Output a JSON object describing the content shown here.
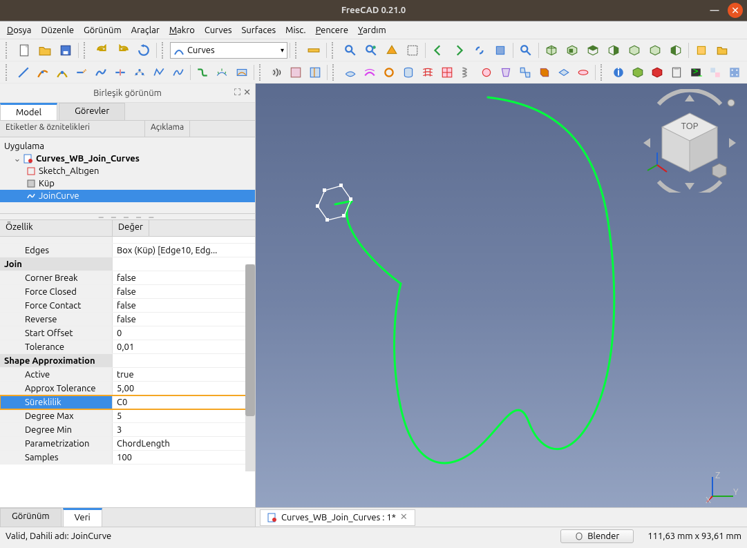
{
  "titlebar": {
    "title": "FreeCAD 0.21.0"
  },
  "menu": {
    "file": "Dosya",
    "edit": "Düzenle",
    "view": "Görünüm",
    "tools": "Araçlar",
    "macro": "Makro",
    "curves": "Curves",
    "surfaces": "Surfaces",
    "misc": "Misc.",
    "windows": "Pencere",
    "help": "Yardım"
  },
  "workbench": {
    "name": "Curves"
  },
  "panel": {
    "title": "Birleşik görünüm",
    "tabs": {
      "model": "Model",
      "tasks": "Görevler"
    },
    "tree_head": {
      "labels": "Etiketler & öznitelikleri",
      "desc": "Açıklama"
    },
    "app": "Uygulama",
    "doc": "Curves_WB_Join_Curves",
    "items": {
      "sketch": "Sketch_Altıgen",
      "cube": "Küp",
      "join": "JoinCurve"
    }
  },
  "props": {
    "head": {
      "property": "Özellik",
      "value": "Değer"
    },
    "rows": [
      {
        "name": "Edges",
        "value": "Box (Küp) [Edge10, Edg...",
        "ind": true
      },
      {
        "grp": true,
        "name": "Join",
        "value": ""
      },
      {
        "name": "Corner Break",
        "value": "false",
        "ind": true
      },
      {
        "name": "Force Closed",
        "value": "false",
        "ind": true
      },
      {
        "name": "Force Contact",
        "value": "false",
        "ind": true
      },
      {
        "name": "Reverse",
        "value": "false",
        "ind": true
      },
      {
        "name": "Start Offset",
        "value": "0",
        "ind": true
      },
      {
        "name": "Tolerance",
        "value": "0,01",
        "ind": true
      },
      {
        "grp": true,
        "name": "Shape Approximation",
        "value": ""
      },
      {
        "name": "Active",
        "value": "true",
        "ind": true
      },
      {
        "name": "Approx Tolerance",
        "value": "5,00",
        "ind": true
      },
      {
        "name": "Süreklilik",
        "value": "C0",
        "ind": true,
        "hl": true
      },
      {
        "name": "Degree Max",
        "value": "5",
        "ind": true
      },
      {
        "name": "Degree Min",
        "value": "3",
        "ind": true
      },
      {
        "name": "Parametrization",
        "value": "ChordLength",
        "ind": true
      },
      {
        "name": "Samples",
        "value": "100",
        "ind": true
      }
    ],
    "tabs": {
      "view": "Görünüm",
      "data": "Veri"
    }
  },
  "doc_tab": {
    "label": "Curves_WB_Join_Curves : 1*"
  },
  "status": {
    "text": "Valid, Dahili adı: JoinCurve",
    "button": "Blender",
    "coords": "111,63 mm x 93,61 mm"
  },
  "splitter": "– – – – –"
}
